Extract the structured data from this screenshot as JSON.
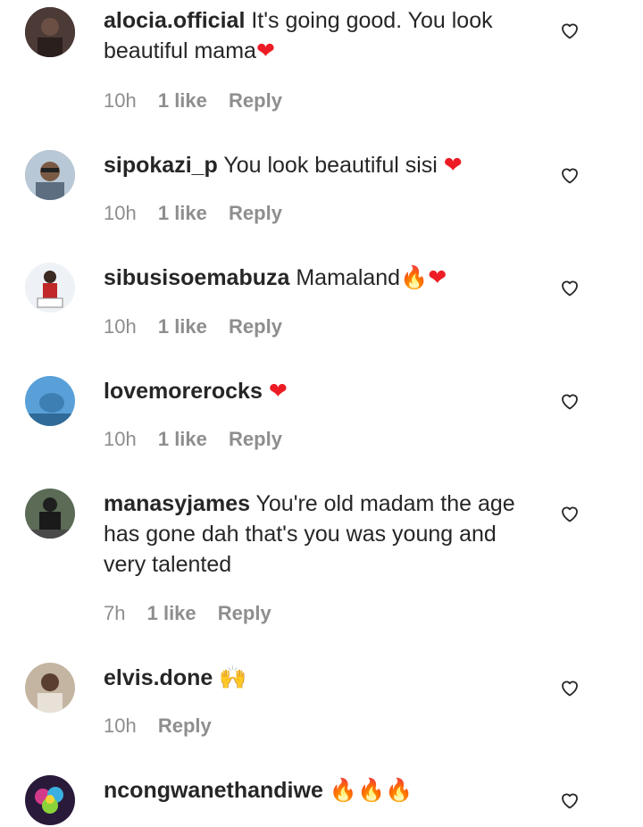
{
  "comments": [
    {
      "username": "alocia.official",
      "text": "It's going good. You look beautiful mama",
      "emoji": "❤",
      "time": "10h",
      "likes": "1 like",
      "reply": "Reply",
      "avatar_color": "#3a2a2a"
    },
    {
      "username": "sipokazi_p",
      "text": "You look beautiful sisi",
      "emoji": "❤",
      "time": "10h",
      "likes": "1 like",
      "reply": "Reply",
      "avatar_color": "#8fa3b8"
    },
    {
      "username": "sibusisoemabuza",
      "text": "Mamaland",
      "emoji": "🔥❤",
      "time": "10h",
      "likes": "1 like",
      "reply": "Reply",
      "avatar_color": "#b22a2a"
    },
    {
      "username": "lovemorerocks",
      "text": "",
      "emoji": "❤",
      "time": "10h",
      "likes": "1 like",
      "reply": "Reply",
      "avatar_color": "#4a8cc0"
    },
    {
      "username": "manasyjames",
      "text": "You're old madam the age has gone dah that's you was young and very talented",
      "emoji": "",
      "time": "7h",
      "likes": "1 like",
      "reply": "Reply",
      "avatar_color": "#2d3a2a"
    },
    {
      "username": "elvis.done",
      "text": "",
      "emoji": "🙌",
      "time": "10h",
      "likes": "",
      "reply": "Reply",
      "avatar_color": "#9b8a76"
    },
    {
      "username": "ncongwanethandiwe",
      "text": "",
      "emoji": "🔥🔥🔥",
      "time": "",
      "likes": "",
      "reply": "",
      "avatar_color": "#6b2a8a"
    }
  ],
  "colors": {
    "heart_red": "#ed1c24",
    "fire_orange": "#f26b1d",
    "meta_gray": "#8e8e8e"
  }
}
